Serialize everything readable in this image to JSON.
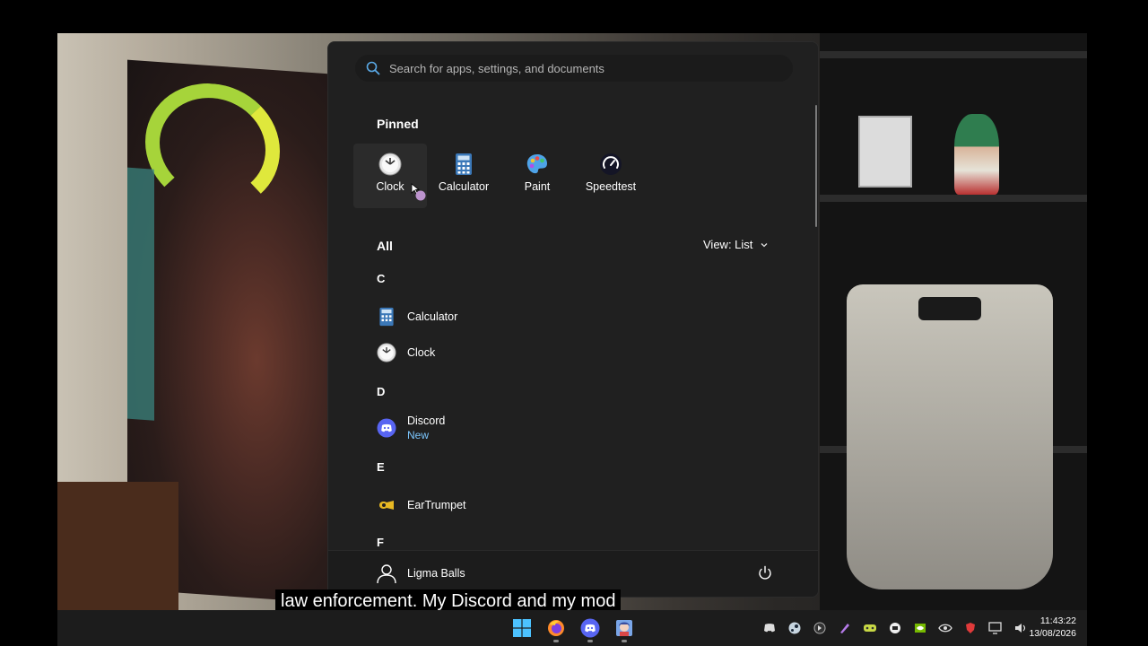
{
  "search": {
    "placeholder": "Search for apps, settings, and documents"
  },
  "pinned": {
    "title": "Pinned",
    "items": [
      {
        "label": "Clock",
        "icon": "clock-icon"
      },
      {
        "label": "Calculator",
        "icon": "calculator-icon"
      },
      {
        "label": "Paint",
        "icon": "paint-icon"
      },
      {
        "label": "Speedtest",
        "icon": "speedtest-icon"
      }
    ]
  },
  "all": {
    "title": "All",
    "view_label": "View: List"
  },
  "groups": [
    {
      "letter": "C",
      "apps": [
        {
          "name": "Calculator",
          "icon": "calculator-icon"
        },
        {
          "name": "Clock",
          "icon": "clock-icon"
        }
      ]
    },
    {
      "letter": "D",
      "apps": [
        {
          "name": "Discord",
          "sub": "New",
          "icon": "discord-icon"
        }
      ]
    },
    {
      "letter": "E",
      "apps": [
        {
          "name": "EarTrumpet",
          "icon": "eartrumpet-icon"
        }
      ]
    },
    {
      "letter": "F",
      "apps": []
    }
  ],
  "footer": {
    "user_name": "Ligma Balls"
  },
  "caption": {
    "text": "law enforcement. My Discord and my mod"
  },
  "taskbar": {
    "apps": [
      "start-icon",
      "firefox-icon",
      "discord-icon",
      "anime-app-icon"
    ],
    "tray": [
      "discord-tray-icon",
      "steam-icon",
      "app-tray-icon",
      "pen-icon",
      "controller-icon",
      "media-icon",
      "nvidia-icon",
      "eye-icon",
      "antivirus-icon",
      "network-icon",
      "volume-icon"
    ],
    "time": "11:43:22",
    "date": "13/08/2026"
  },
  "colors": {
    "accent": "#7cc7ff",
    "menu_bg": "#202020",
    "discord": "#5865f2"
  }
}
